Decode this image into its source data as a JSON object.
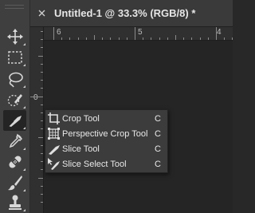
{
  "document_tab": {
    "title": "Untitled-1 @ 33.3% (RGB/8) *"
  },
  "rulers": {
    "horizontal": [
      "6",
      "5",
      "4"
    ],
    "vertical": [
      "0"
    ]
  },
  "toolbar": {
    "tools": [
      {
        "name": "move-tool",
        "icon": "move-icon"
      },
      {
        "name": "rectangular-marquee-tool",
        "icon": "marquee-icon"
      },
      {
        "name": "lasso-tool",
        "icon": "lasso-icon"
      },
      {
        "name": "quick-selection-tool",
        "icon": "quick-selection-icon"
      },
      {
        "name": "slice-tool",
        "icon": "slice-icon",
        "active": true
      },
      {
        "name": "eyedropper-tool",
        "icon": "eyedropper-icon"
      },
      {
        "name": "healing-brush-tool",
        "icon": "bandage-icon"
      },
      {
        "name": "brush-tool",
        "icon": "brush-icon"
      },
      {
        "name": "clone-stamp-tool",
        "icon": "stamp-icon"
      }
    ]
  },
  "flyout": {
    "items": [
      {
        "label": "Crop Tool",
        "shortcut": "C",
        "icon": "crop-icon"
      },
      {
        "label": "Perspective Crop Tool",
        "shortcut": "C",
        "icon": "perspective-crop-icon"
      },
      {
        "label": "Slice Tool",
        "shortcut": "C",
        "icon": "slice-icon",
        "selected": true
      },
      {
        "label": "Slice Select Tool",
        "shortcut": "C",
        "icon": "slice-select-icon"
      }
    ]
  },
  "colors": {
    "toolbar_bg": "#3f3f3f",
    "canvas_bg": "#252525",
    "flyout_bg": "#3c3c3c",
    "text": "#e8e8e8"
  }
}
